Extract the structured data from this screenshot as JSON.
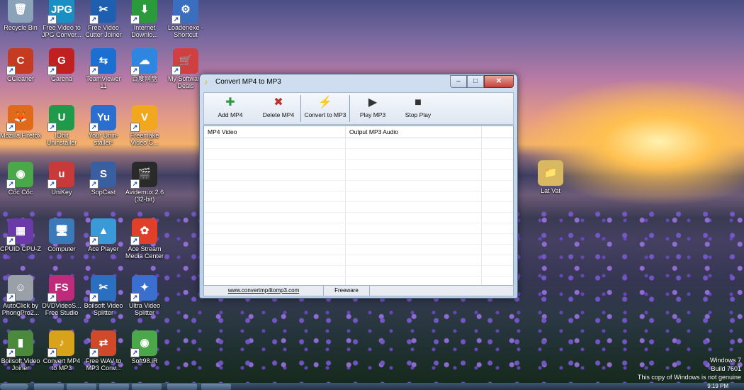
{
  "desktop": {
    "icons": [
      {
        "label": "Recycle Bin",
        "glyph": "🗑",
        "color": "#8aa3b8",
        "arrow": false
      },
      {
        "label": "Free Video to JPG Conver...",
        "glyph": "JPG",
        "color": "#1a8fc4",
        "arrow": true
      },
      {
        "label": "Free Video Cutter Joiner",
        "glyph": "✂",
        "color": "#1f5fb0",
        "arrow": true
      },
      {
        "label": "Internet Downlo...",
        "glyph": "⬇",
        "color": "#2a9a3a",
        "arrow": true
      },
      {
        "label": "Loadenexe - Shortcut",
        "glyph": "⚙",
        "color": "#3a6fc0",
        "arrow": true
      },
      {
        "label": "CCleaner",
        "glyph": "C",
        "color": "#c43b22",
        "arrow": true
      },
      {
        "label": "Garena",
        "glyph": "G",
        "color": "#c02020",
        "arrow": true
      },
      {
        "label": "TeamViewer 11",
        "glyph": "⇆",
        "color": "#1a6fd0",
        "arrow": true
      },
      {
        "label": "百度网盘",
        "glyph": "☁",
        "color": "#2f86e0",
        "arrow": true
      },
      {
        "label": "My Software Deals",
        "glyph": "🛒",
        "color": "#d04040",
        "arrow": true
      },
      {
        "label": "Mozilla Firefox",
        "glyph": "🦊",
        "color": "#e06a1a",
        "arrow": true
      },
      {
        "label": "IObit Uninstaller",
        "glyph": "U",
        "color": "#1f9a4a",
        "arrow": true
      },
      {
        "label": "Your Unin-staller!",
        "glyph": "Yu",
        "color": "#2a6fd0",
        "arrow": true
      },
      {
        "label": "Freemake Video C...",
        "glyph": "V",
        "color": "#f2a81e",
        "arrow": true
      },
      {
        "label": "Cốc Cốc",
        "glyph": "◉",
        "color": "#4aa84a",
        "arrow": true
      },
      {
        "label": "UniKey",
        "glyph": "u",
        "color": "#c83a3a",
        "arrow": true
      },
      {
        "label": "SopCast",
        "glyph": "S",
        "color": "#3a5fa0",
        "arrow": true
      },
      {
        "label": "Avidemux 2.6 (32-bit)",
        "glyph": "🎬",
        "color": "#2a2a2a",
        "arrow": true
      },
      {
        "label": "CPUID CPU-Z",
        "glyph": "▦",
        "color": "#6a3aa8",
        "arrow": true
      },
      {
        "label": "Computer",
        "glyph": "🖥",
        "color": "#3a7ab8",
        "arrow": false
      },
      {
        "label": "Ace Player",
        "glyph": "▲",
        "color": "#3a9ad8",
        "arrow": true
      },
      {
        "label": "Ace Stream Media Center",
        "glyph": "✿",
        "color": "#e0402a",
        "arrow": true
      },
      {
        "label": "AutoClick by PhongPro2...",
        "glyph": "☺",
        "color": "#9aa0a8",
        "arrow": true
      },
      {
        "label": "DVDVideoS... Free Studio",
        "glyph": "FS",
        "color": "#c02a7a",
        "arrow": true
      },
      {
        "label": "Boilsoft Video Splitter",
        "glyph": "✂",
        "color": "#2a6fc0",
        "arrow": true
      },
      {
        "label": "Ultra Video Splitter",
        "glyph": "✦",
        "color": "#3a6fd0",
        "arrow": true
      },
      {
        "label": "Boilsoft Video Joiner",
        "glyph": "▮",
        "color": "#4a8a3a",
        "arrow": true
      },
      {
        "label": "Convert MP4 to MP3",
        "glyph": "♪",
        "color": "#d8a21a",
        "arrow": true
      },
      {
        "label": "Free WAV to MP3 Conv...",
        "glyph": "⇄",
        "color": "#d04a2a",
        "arrow": true
      },
      {
        "label": "Soft98.iR",
        "glyph": "◉",
        "color": "#4aa84a",
        "arrow": true
      },
      {
        "label": "Lat Vat",
        "glyph": "📁",
        "color": "#d8b860",
        "arrow": false
      }
    ]
  },
  "window": {
    "title": "Convert MP4 to MP3",
    "controls": {
      "minimize": "–",
      "maximize": "□",
      "close": "✕"
    },
    "toolbar": {
      "add": {
        "label": "Add MP4",
        "icon": "add-icon",
        "glyph": "🎸",
        "color": "#2a9a3a"
      },
      "delete": {
        "label": "Delete MP4",
        "icon": "delete-icon",
        "glyph": "🎸",
        "color": "#c03030"
      },
      "convert": {
        "label": "Convert to MP3",
        "icon": "lightning-icon",
        "glyph": "⚡",
        "color": "#e0a800"
      },
      "play": {
        "label": "Play MP3",
        "icon": "play-icon",
        "glyph": "▶",
        "color": "#333333"
      },
      "stop": {
        "label": "Stop Play",
        "icon": "stop-icon",
        "glyph": "■",
        "color": "#333333"
      }
    },
    "list": {
      "columns": [
        "MP4 Video",
        "Output MP3 Audio"
      ],
      "rows": []
    },
    "statusbar": {
      "link": "www.convertmp4tomp3.com",
      "type": "Freeware"
    }
  },
  "watermark": {
    "line1": "Windows 7",
    "line2": "Build 7601",
    "line3": "This copy of Windows is not genuine"
  },
  "taskbar": {
    "clock": "9:19 PM"
  }
}
